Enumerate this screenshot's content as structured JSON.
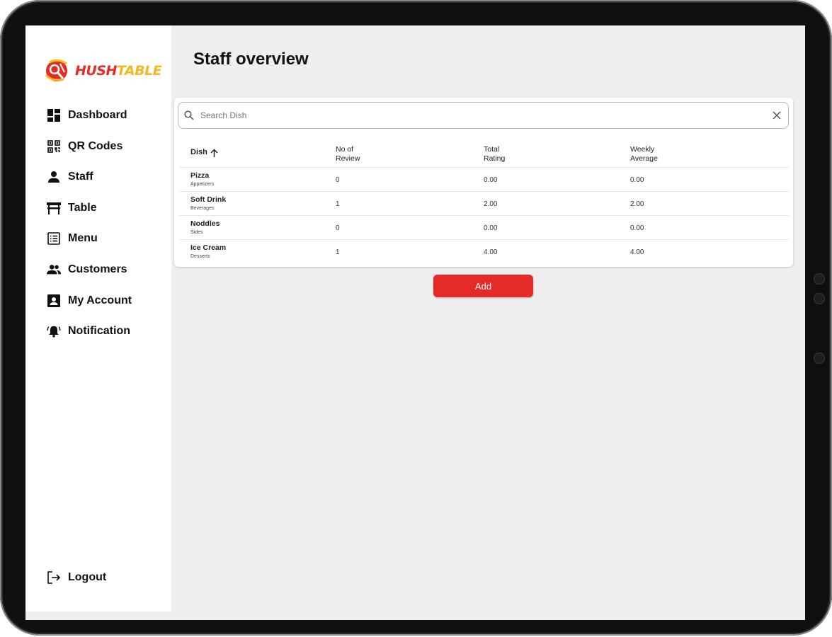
{
  "app": {
    "logo_hush": "HUSH",
    "logo_table": "TABLE",
    "brand_red": "#e52b24",
    "brand_yellow": "#f2b823"
  },
  "sidebar": {
    "items": [
      {
        "label": "Dashboard",
        "icon": "dashboard-icon"
      },
      {
        "label": "QR Codes",
        "icon": "qr-code-icon"
      },
      {
        "label": "Staff",
        "icon": "person-icon"
      },
      {
        "label": "Table",
        "icon": "table-icon"
      },
      {
        "label": "Menu",
        "icon": "menu-list-icon"
      },
      {
        "label": "Customers",
        "icon": "group-icon"
      },
      {
        "label": "My Account",
        "icon": "account-box-icon"
      },
      {
        "label": "Notification",
        "icon": "bell-icon"
      }
    ],
    "logout_label": "Logout"
  },
  "page": {
    "title": "Staff overview"
  },
  "search": {
    "placeholder": "Search Dish",
    "value": ""
  },
  "table": {
    "headers": {
      "dish": "Dish",
      "reviews_line1": "No of",
      "reviews_line2": "Review",
      "total_line1": "Total",
      "total_line2": "Rating",
      "weekly_line1": "Weekly",
      "weekly_line2": "Average"
    },
    "sort": "ascending",
    "rows": [
      {
        "name": "Pizza",
        "category": "Appetizers",
        "reviews": "0",
        "total": "0.00",
        "weekly": "0.00"
      },
      {
        "name": "Soft Drink",
        "category": "Beverages",
        "reviews": "1",
        "total": "2.00",
        "weekly": "2.00"
      },
      {
        "name": "Noddles",
        "category": "Sides",
        "reviews": "0",
        "total": "0.00",
        "weekly": "0.00"
      },
      {
        "name": "Ice Cream",
        "category": "Desserts",
        "reviews": "1",
        "total": "4.00",
        "weekly": "4.00"
      }
    ]
  },
  "actions": {
    "add_label": "Add",
    "add_color": "#e42b27"
  }
}
